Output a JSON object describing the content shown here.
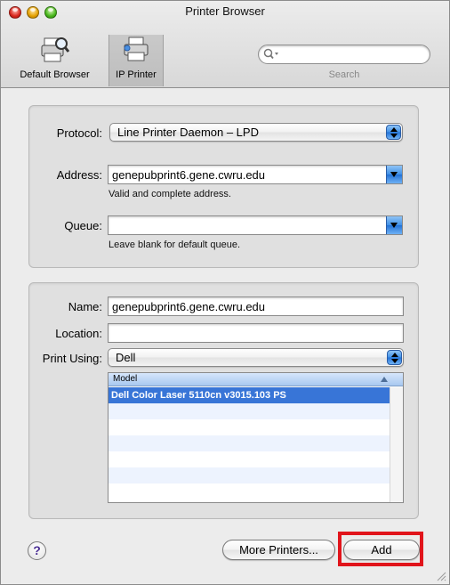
{
  "window": {
    "title": "Printer Browser"
  },
  "toolbar": {
    "default_browser_label": "Default Browser",
    "ip_printer_label": "IP Printer",
    "search_placeholder": "",
    "search_label": "Search"
  },
  "connection": {
    "protocol_label": "Protocol:",
    "protocol_value": "Line Printer Daemon – LPD",
    "address_label": "Address:",
    "address_value": "genepubprint6.gene.cwru.edu",
    "address_hint": "Valid and complete address.",
    "queue_label": "Queue:",
    "queue_value": "",
    "queue_hint": "Leave blank for default queue."
  },
  "printer": {
    "name_label": "Name:",
    "name_value": "genepubprint6.gene.cwru.edu",
    "location_label": "Location:",
    "location_value": "",
    "print_using_label": "Print Using:",
    "print_using_value": "Dell",
    "model_header": "Model",
    "models": [
      "Dell Color Laser 5110cn v3015.103 PS"
    ]
  },
  "buttons": {
    "help_label": "?",
    "more_printers_label": "More Printers...",
    "add_label": "Add"
  },
  "colors": {
    "highlight": "#e1141b",
    "selection": "#3875d7",
    "aqua": "#3f8fe5"
  }
}
